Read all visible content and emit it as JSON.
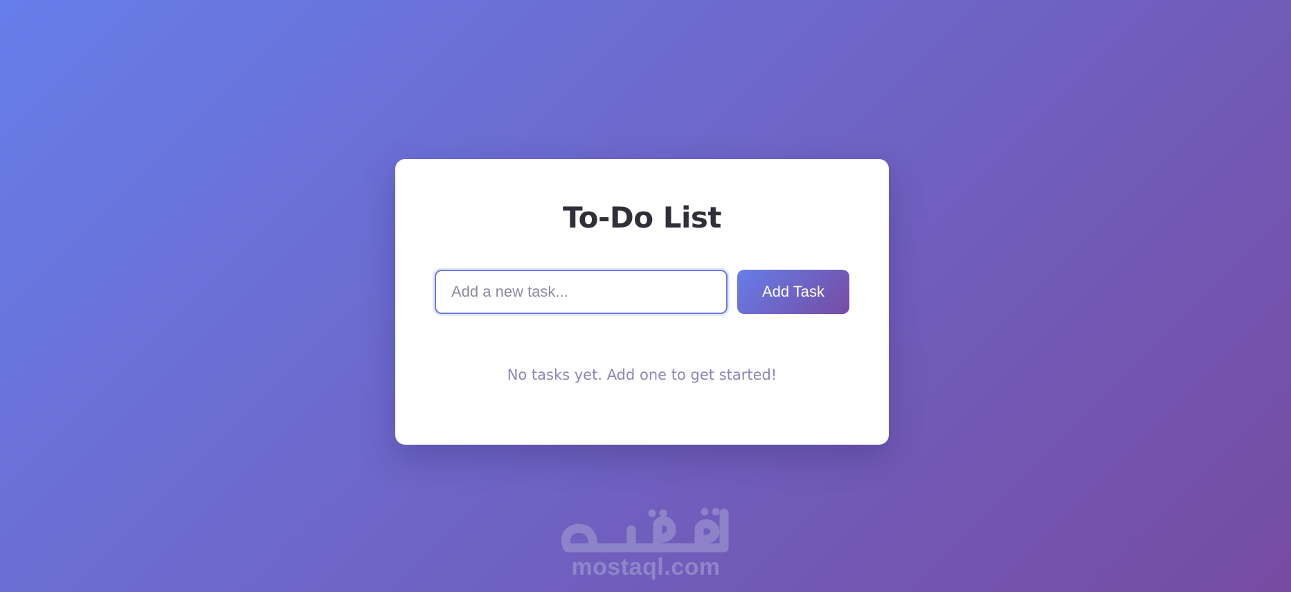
{
  "app": {
    "title": "To-Do List"
  },
  "task_form": {
    "input_value": "",
    "input_placeholder": "Add a new task...",
    "add_button_label": "Add Task"
  },
  "task_list": {
    "items": [],
    "empty_message": "No tasks yet. Add one to get started!"
  },
  "watermark": {
    "logo_text": "مستقل",
    "site_text": "mostaql.com"
  },
  "colors": {
    "background_gradient_start": "#667eea",
    "background_gradient_end": "#764ba2",
    "card_background": "#ffffff",
    "title_text": "#2f2f3a",
    "input_border_focus": "#6b7ae6",
    "empty_message_text": "#8b86b8"
  }
}
